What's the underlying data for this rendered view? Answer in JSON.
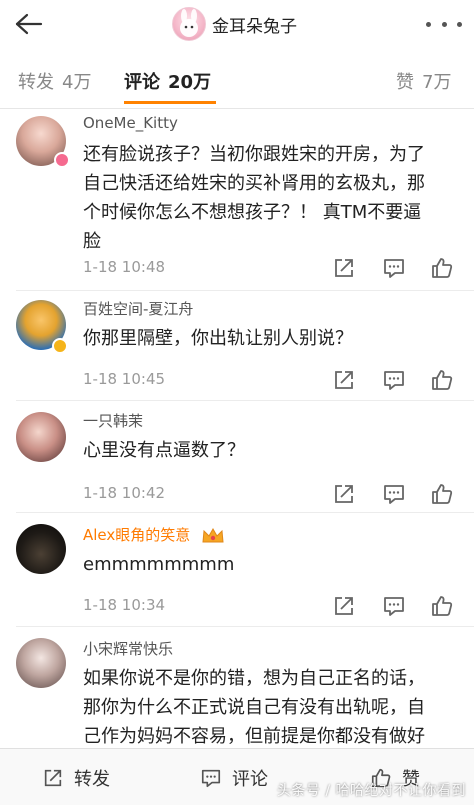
{
  "header": {
    "title": "金耳朵兔子"
  },
  "tabs": {
    "repost": {
      "label": "转发",
      "count": "4万"
    },
    "comment": {
      "label": "评论",
      "count": "20万"
    },
    "like": {
      "label": "赞",
      "count": "7万"
    }
  },
  "comments": [
    {
      "username": "OneMe_Kitty",
      "line1": "还有脸说孩子？当初你跟姓宋的开房，为了",
      "line2": "自己快活还给姓宋的买补肾用的玄极丸，那",
      "line3": "个时候你怎么不想想孩子？！ 真TM不要逼",
      "line4": "脸",
      "time": "1-18 10:48"
    },
    {
      "username": "百姓空间-夏江舟",
      "line1": "你那里隔壁，你出轨让别人别说？",
      "time": "1-18 10:45"
    },
    {
      "username": "一只韩茉",
      "line1": "心里没有点逼数了？",
      "time": "1-18 10:42"
    },
    {
      "username": "Alex眼角的笑意",
      "line1": "emmmmmmmm",
      "time": "1-18 10:34"
    },
    {
      "username": "小宋辉常快乐",
      "line1": "如果你说不是你的错，想为自己正名的话，",
      "line2": "那你为什么不正式说自己有没有出轨呢，自",
      "line3": "己作为妈妈不容易，但前提是你都没有做好"
    }
  ],
  "bottom": {
    "repost": "转发",
    "comment": "评论",
    "like": "赞"
  },
  "watermark": "头条号 / 哈哈绝对不让你看到"
}
